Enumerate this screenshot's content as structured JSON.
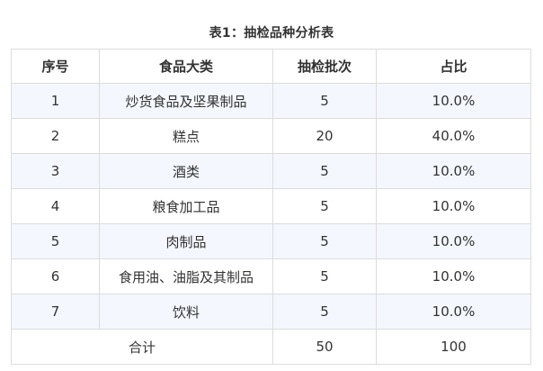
{
  "caption": "表1：抽检品种分析表",
  "columns": [
    "序号",
    "食品大类",
    "抽检批次",
    "占比"
  ],
  "rows": [
    [
      "1",
      "炒货食品及坚果制品",
      "5",
      "10.0%"
    ],
    [
      "2",
      "糕点",
      "20",
      "40.0%"
    ],
    [
      "3",
      "酒类",
      "5",
      "10.0%"
    ],
    [
      "4",
      "粮食加工品",
      "5",
      "10.0%"
    ],
    [
      "5",
      "肉制品",
      "5",
      "10.0%"
    ],
    [
      "6",
      "食用油、油脂及其制品",
      "5",
      "10.0%"
    ],
    [
      "7",
      "饮料",
      "5",
      "10.0%"
    ]
  ],
  "total": {
    "label": "合计",
    "count": "50",
    "share": "100"
  }
}
